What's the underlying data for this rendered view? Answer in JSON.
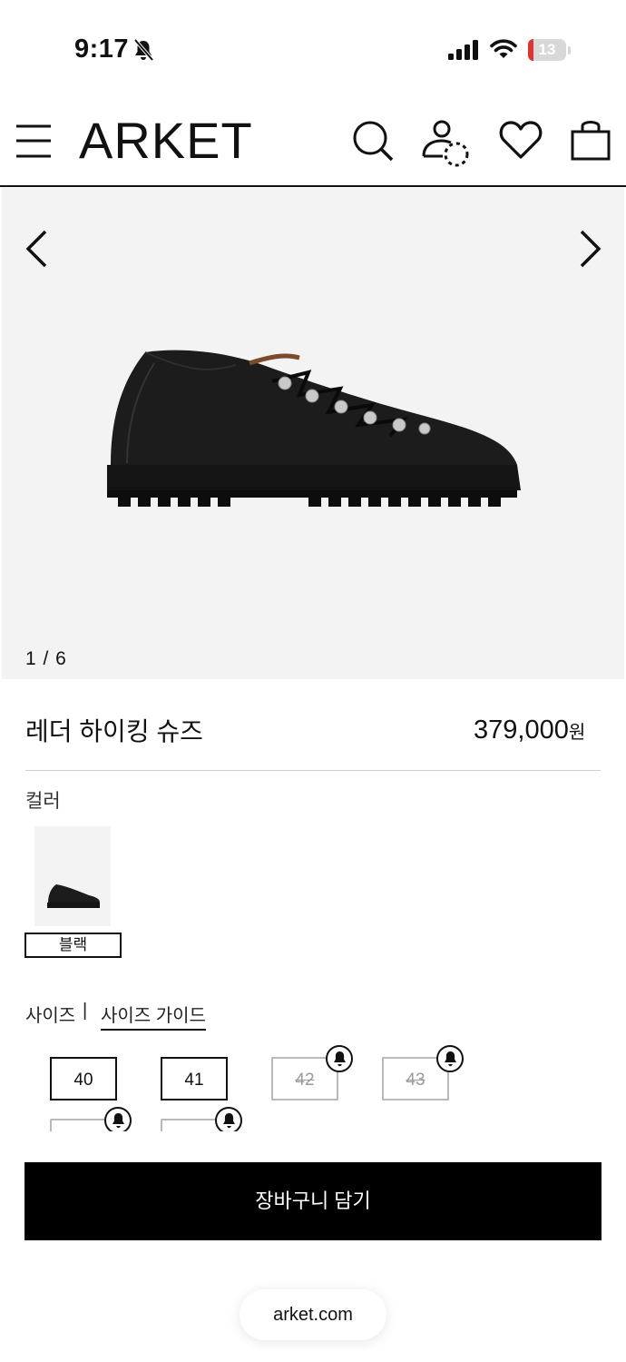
{
  "status_bar": {
    "time": "9:17",
    "battery": "13",
    "icons": [
      "bell-off-icon",
      "signal-icon",
      "wifi-icon",
      "battery-icon"
    ]
  },
  "header": {
    "logo": "ARKET",
    "icons": [
      "menu-icon",
      "search-icon",
      "account-icon",
      "heart-icon",
      "bag-icon"
    ]
  },
  "gallery": {
    "counter": "1 / 6"
  },
  "product": {
    "title": "레더 하이킹 슈즈",
    "price": "379,000",
    "currency": "원"
  },
  "color": {
    "label": "컬러",
    "selected": "블랙"
  },
  "size": {
    "label": "사이즈",
    "separator": "|",
    "guide": "사이즈 가이드",
    "options": [
      {
        "label": "40",
        "available": true
      },
      {
        "label": "41",
        "available": true
      },
      {
        "label": "42",
        "available": false
      },
      {
        "label": "43",
        "available": false
      }
    ]
  },
  "actions": {
    "add_to_cart": "장바구니 담기"
  },
  "browser": {
    "url": "arket.com"
  },
  "colors": {
    "accent": "#000000",
    "battery_low": "#e0312f",
    "gallery_bg": "#f3f3f3"
  }
}
